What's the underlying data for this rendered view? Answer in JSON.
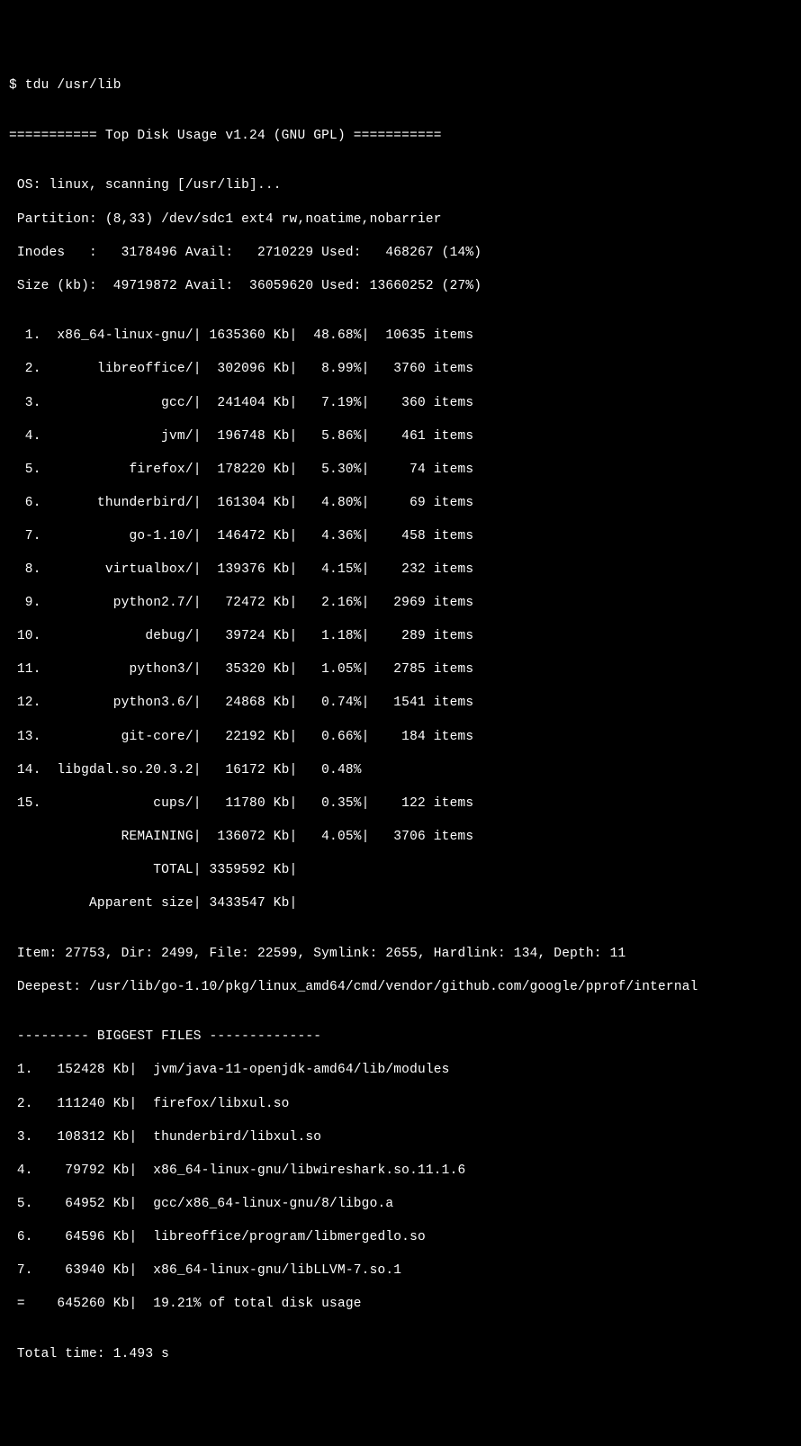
{
  "prompt": "$ tdu /usr/lib",
  "blank": "",
  "header": "=========== Top Disk Usage v1.24 (GNU GPL) ===========",
  "os_line": " OS: linux, scanning [/usr/lib]...",
  "partition_line": " Partition: (8,33) /dev/sdc1 ext4 rw,noatime,nobarrier",
  "inodes_line": " Inodes   :   3178496 Avail:   2710229 Used:   468267 (14%)",
  "size_line": " Size (kb):  49719872 Avail:  36059620 Used: 13660252 (27%)",
  "rows": {
    "r1": "  1.  x86_64-linux-gnu/| 1635360 Kb|  48.68%|  10635 items",
    "r2": "  2.       libreoffice/|  302096 Kb|   8.99%|   3760 items",
    "r3": "  3.               gcc/|  241404 Kb|   7.19%|    360 items",
    "r4": "  4.               jvm/|  196748 Kb|   5.86%|    461 items",
    "r5": "  5.           firefox/|  178220 Kb|   5.30%|     74 items",
    "r6": "  6.       thunderbird/|  161304 Kb|   4.80%|     69 items",
    "r7": "  7.           go-1.10/|  146472 Kb|   4.36%|    458 items",
    "r8": "  8.        virtualbox/|  139376 Kb|   4.15%|    232 items",
    "r9": "  9.         python2.7/|   72472 Kb|   2.16%|   2969 items",
    "r10": " 10.             debug/|   39724 Kb|   1.18%|    289 items",
    "r11": " 11.           python3/|   35320 Kb|   1.05%|   2785 items",
    "r12": " 12.         python3.6/|   24868 Kb|   0.74%|   1541 items",
    "r13": " 13.          git-core/|   22192 Kb|   0.66%|    184 items",
    "r14": " 14.  libgdal.so.20.3.2|   16172 Kb|   0.48%",
    "r15": " 15.              cups/|   11780 Kb|   0.35%|    122 items",
    "remaining": "              REMAINING|  136072 Kb|   4.05%|   3706 items",
    "total": "                  TOTAL| 3359592 Kb|",
    "apparent": "          Apparent size| 3433547 Kb|"
  },
  "item_line": " Item: 27753, Dir: 2499, File: 22599, Symlink: 2655, Hardlink: 134, Depth: 11",
  "deepest_line": " Deepest: /usr/lib/go-1.10/pkg/linux_amd64/cmd/vendor/github.com/google/pprof/internal",
  "biggest_header": " --------- BIGGEST FILES --------------",
  "biggest": {
    "b1": " 1.   152428 Kb|  jvm/java-11-openjdk-amd64/lib/modules",
    "b2": " 2.   111240 Kb|  firefox/libxul.so",
    "b3": " 3.   108312 Kb|  thunderbird/libxul.so",
    "b4": " 4.    79792 Kb|  x86_64-linux-gnu/libwireshark.so.11.1.6",
    "b5": " 5.    64952 Kb|  gcc/x86_64-linux-gnu/8/libgo.a",
    "b6": " 6.    64596 Kb|  libreoffice/program/libmergedlo.so",
    "b7": " 7.    63940 Kb|  x86_64-linux-gnu/libLLVM-7.so.1",
    "bsum": " =    645260 Kb|  19.21% of total disk usage"
  },
  "total_time": " Total time: 1.493 s"
}
